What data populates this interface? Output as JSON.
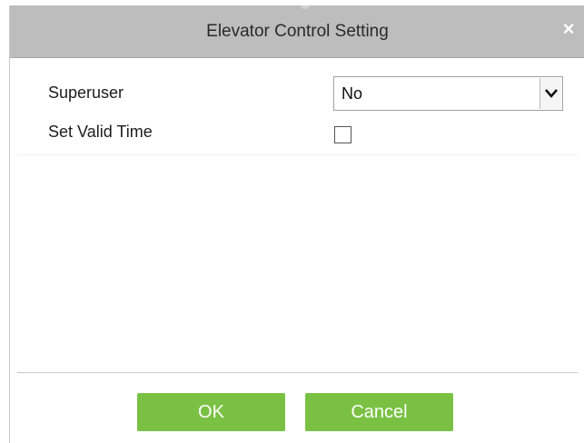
{
  "dialog": {
    "title": "Elevator Control Setting",
    "close_glyph": "×"
  },
  "form": {
    "superuser": {
      "label": "Superuser",
      "selected": "No"
    },
    "valid_time": {
      "label": "Set Valid Time",
      "checked": false
    }
  },
  "footer": {
    "ok_label": "OK",
    "cancel_label": "Cancel"
  },
  "colors": {
    "titlebar": "#bdbdbd",
    "button": "#7ac143"
  },
  "icons": {
    "close": "close-icon",
    "dropdown": "chevron-down-icon"
  }
}
